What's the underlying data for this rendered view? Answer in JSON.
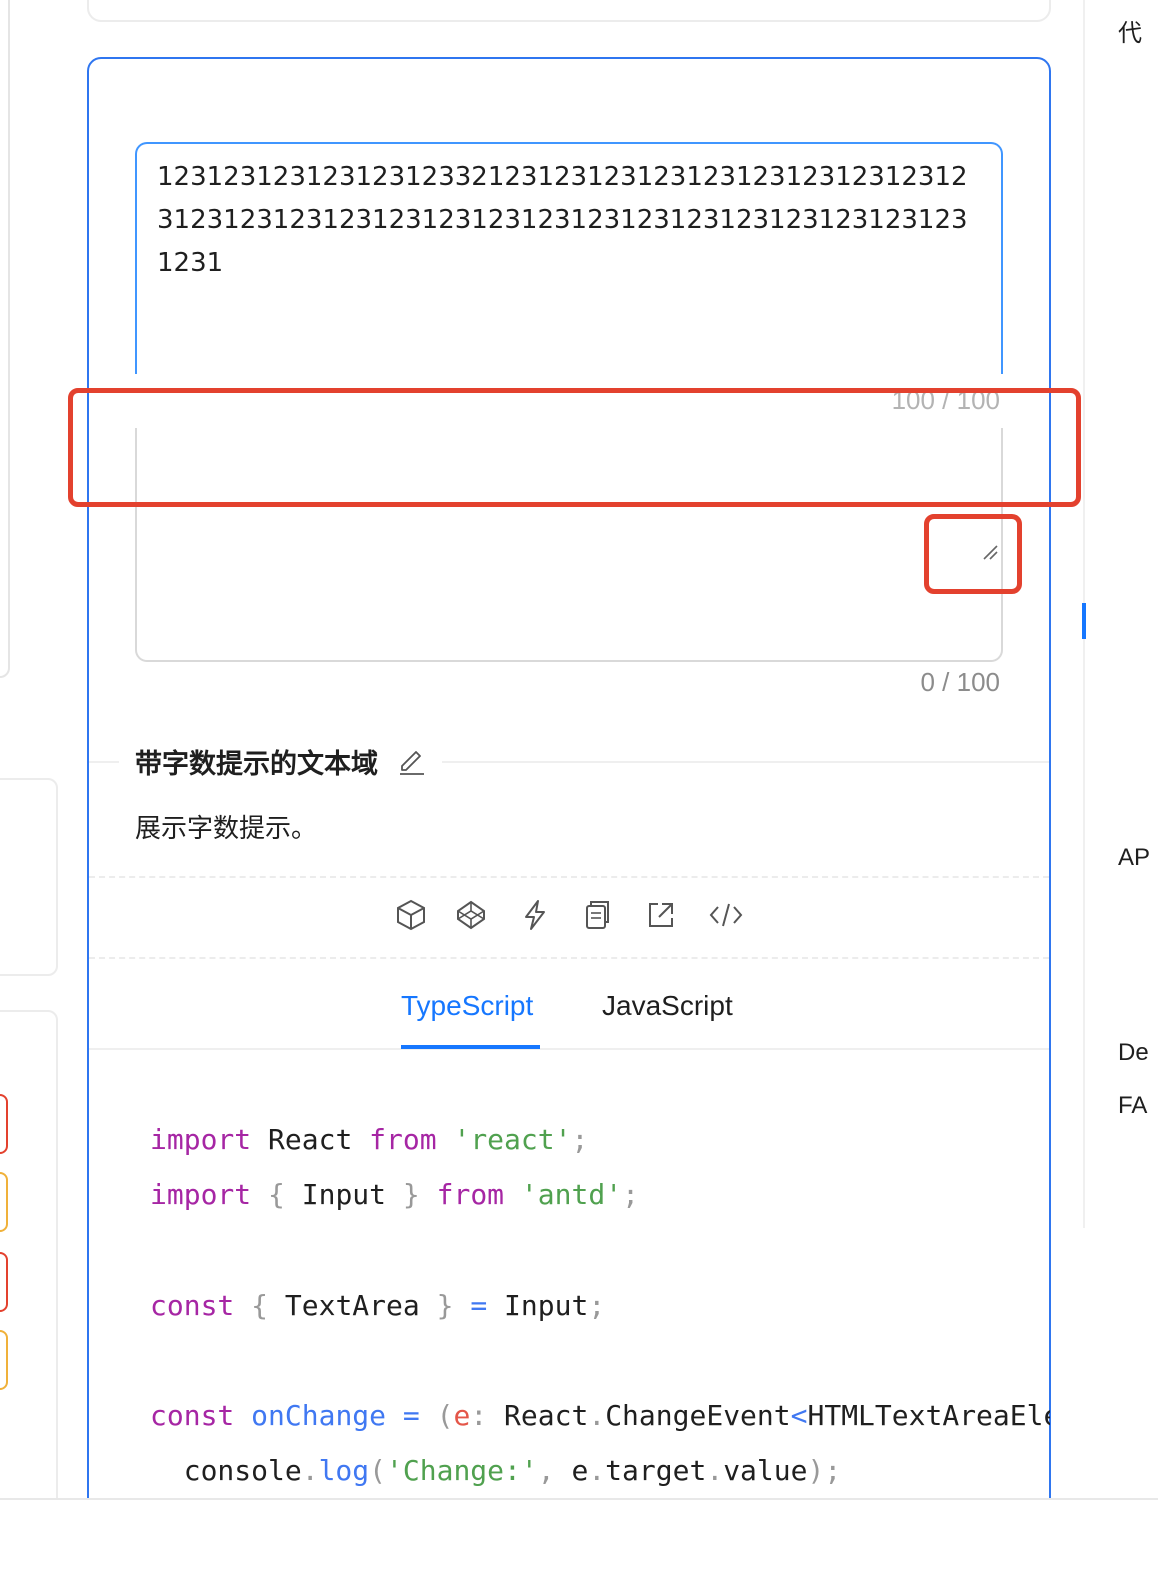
{
  "demo": {
    "textarea_filled_value": "123123123123123123321231231231231231231231231231231231231231231231231231231231231231231231231231231231",
    "textarea_filled_counter": "100 / 100",
    "textarea_empty_value": "",
    "textarea_empty_counter": "0 / 100",
    "title": "带字数提示的文本域",
    "description": "展示字数提示。",
    "actions": [
      "codesandbox-icon",
      "codepen-icon",
      "stackblitz-icon",
      "copy-icon",
      "open-external-icon",
      "expand-code-icon"
    ]
  },
  "tabs": {
    "typescript": "TypeScript",
    "javascript": "JavaScript",
    "active": "TypeScript"
  },
  "code": {
    "line1": {
      "kw1": "import",
      "id": " React ",
      "kw2": "from",
      "str": " 'react'",
      "end": ";"
    },
    "line2": {
      "kw1": "import",
      "ob": " { ",
      "id": "Input",
      "cb": " } ",
      "kw2": "from",
      "str": " 'antd'",
      "end": ";"
    },
    "line4": {
      "kw": "const",
      "ob": " { ",
      "id": "TextArea",
      "cb": " } ",
      "op": "=",
      "rest": " Input",
      "end": ";"
    },
    "line6": {
      "kw": "const",
      "fn": " onChange ",
      "op": "=",
      "p1": " (",
      "param": "e",
      "colon": ": ",
      "type": "React",
      "dot": ".",
      "type2": "ChangeEvent",
      "lt": "<",
      "type3": "HTMLTextAreaElement"
    },
    "line7": {
      "obj": "  console",
      "dot": ".",
      "fn": "log",
      "p1": "(",
      "str": "'Change:'",
      "comma": ", ",
      "ident": "e",
      "dot2": ".",
      "prop": "target",
      "dot3": ".",
      "prop2": "value",
      "end": ");"
    }
  },
  "toc": {
    "item_top": "代",
    "item_api": "AP",
    "item_de": "De",
    "item_fa": "FA"
  },
  "colors": {
    "primary": "#1677ff",
    "annotation_red": "#e3412e",
    "keyword": "#a626a4",
    "string": "#50a14f",
    "function": "#4078f2"
  }
}
